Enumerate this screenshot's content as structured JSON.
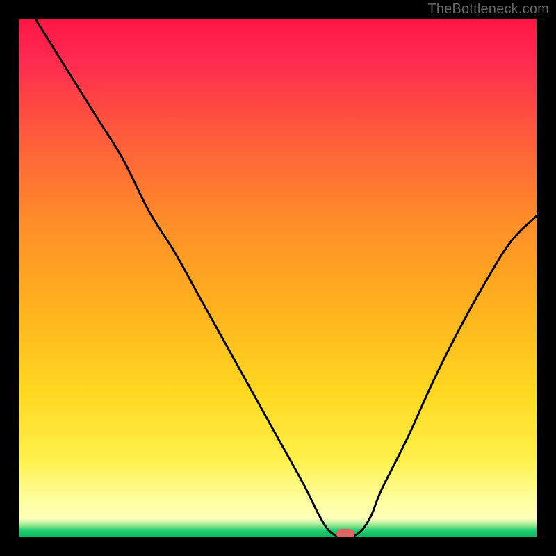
{
  "watermark": "TheBottleneck.com",
  "chart_data": {
    "type": "line",
    "title": "",
    "xlabel": "",
    "ylabel": "",
    "x_range": [
      0,
      1
    ],
    "y_range": [
      0,
      1
    ],
    "series": [
      {
        "name": "bottleneck-curve",
        "x": [
          0.0,
          0.05,
          0.1,
          0.15,
          0.2,
          0.25,
          0.3,
          0.35,
          0.4,
          0.45,
          0.5,
          0.55,
          0.58,
          0.6,
          0.62,
          0.64,
          0.66,
          0.68,
          0.7,
          0.75,
          0.8,
          0.85,
          0.9,
          0.95,
          1.0
        ],
        "y": [
          1.05,
          0.97,
          0.89,
          0.81,
          0.73,
          0.63,
          0.55,
          0.46,
          0.37,
          0.28,
          0.19,
          0.1,
          0.04,
          0.01,
          0.0,
          0.0,
          0.01,
          0.04,
          0.09,
          0.19,
          0.3,
          0.4,
          0.49,
          0.57,
          0.62
        ]
      }
    ],
    "marker": {
      "x": 0.63,
      "y": 0.0
    },
    "gradient_stops": [
      {
        "pos": 0.0,
        "color": "#ff1744"
      },
      {
        "pos": 0.08,
        "color": "#ff2a50"
      },
      {
        "pos": 0.22,
        "color": "#ff5a3c"
      },
      {
        "pos": 0.38,
        "color": "#ff8a2a"
      },
      {
        "pos": 0.55,
        "color": "#ffb01e"
      },
      {
        "pos": 0.72,
        "color": "#ffd820"
      },
      {
        "pos": 0.85,
        "color": "#fff04a"
      },
      {
        "pos": 0.93,
        "color": "#ffffa0"
      },
      {
        "pos": 1.0,
        "color": "#ffffd0"
      }
    ]
  }
}
